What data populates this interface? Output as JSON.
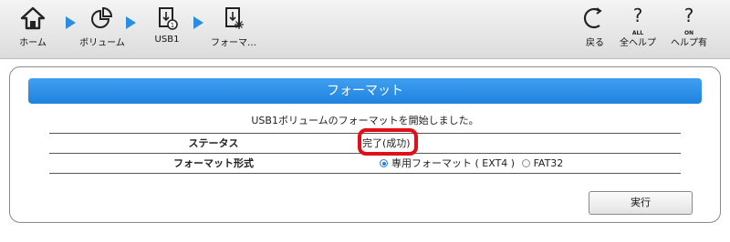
{
  "breadcrumb": [
    {
      "label": "ホーム",
      "icon": "home-icon"
    },
    {
      "label": "ボリューム",
      "icon": "pie-chart-icon"
    },
    {
      "label": "USB1",
      "icon": "usb-storage-icon"
    },
    {
      "label": "フォーマ…",
      "icon": "format-storage-icon"
    }
  ],
  "tools": {
    "back": {
      "label": "戻る",
      "icon": "back-icon"
    },
    "help_all": {
      "label": "全ヘルプ",
      "sub": "ALL",
      "icon": "help-all-icon"
    },
    "help_on": {
      "label": "ヘルプ有",
      "sub": "ON",
      "icon": "help-on-icon"
    }
  },
  "panel": {
    "title": "フォーマット",
    "message": "USB1ボリュームのフォーマットを開始しました。",
    "rows": {
      "status_key": "ステータス",
      "status_value": "完了(成功)",
      "format_key": "フォーマット形式",
      "format_opt1": "専用フォーマット ( EXT4 )",
      "format_opt2": "FAT32",
      "selected": "専用フォーマット ( EXT4 )"
    },
    "execute_label": "実行"
  },
  "colors": {
    "accent": "#2a8ee0",
    "highlight_ring": "#e0101a"
  }
}
